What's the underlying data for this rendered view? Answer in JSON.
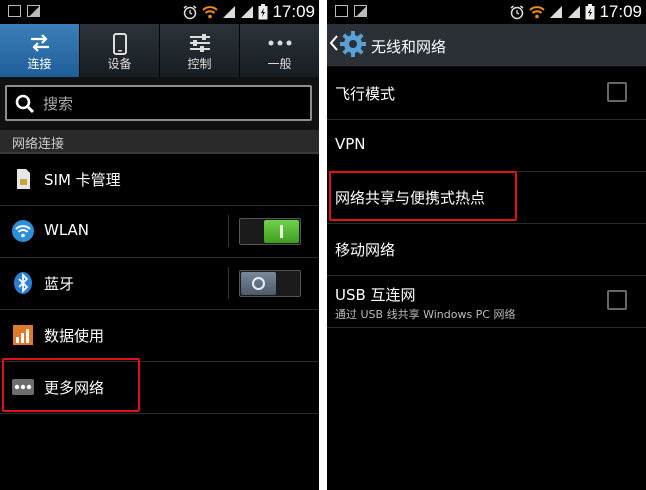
{
  "status_bar": {
    "time": "17:09"
  },
  "left": {
    "tabs": [
      {
        "label": "连接",
        "icon": "arrows-swap-icon",
        "active": true
      },
      {
        "label": "设备",
        "icon": "phone-device-icon",
        "active": false
      },
      {
        "label": "控制",
        "icon": "sliders-icon",
        "active": false
      },
      {
        "label": "一般",
        "icon": "more-dots-icon",
        "active": false
      }
    ],
    "search": {
      "placeholder": "搜索"
    },
    "section_header": "网络连接",
    "items": [
      {
        "label": "SIM 卡管理",
        "icon": "sim-card-icon"
      },
      {
        "label": "WLAN",
        "icon": "wifi-icon",
        "toggle": "on"
      },
      {
        "label": "蓝牙",
        "icon": "bluetooth-icon",
        "toggle": "off"
      },
      {
        "label": "数据使用",
        "icon": "data-usage-chart-icon"
      },
      {
        "label": "更多网络",
        "icon": "more-networks-icon",
        "highlighted": true
      }
    ]
  },
  "right": {
    "title": "无线和网络",
    "items": [
      {
        "label": "飞行模式",
        "checkbox": false
      },
      {
        "label": "VPN"
      },
      {
        "label": "网络共享与便携式热点",
        "highlighted": true
      },
      {
        "label": "移动网络"
      },
      {
        "label": "USB 互连网",
        "sublabel": "通过 USB 线共享 Windows PC 网络",
        "checkbox": false
      }
    ]
  },
  "colors": {
    "active_tab": "#2f6fa8",
    "highlight_border": "#e0111b",
    "toggle_on": "#55b832",
    "toggle_off": "#5f6f7f"
  }
}
